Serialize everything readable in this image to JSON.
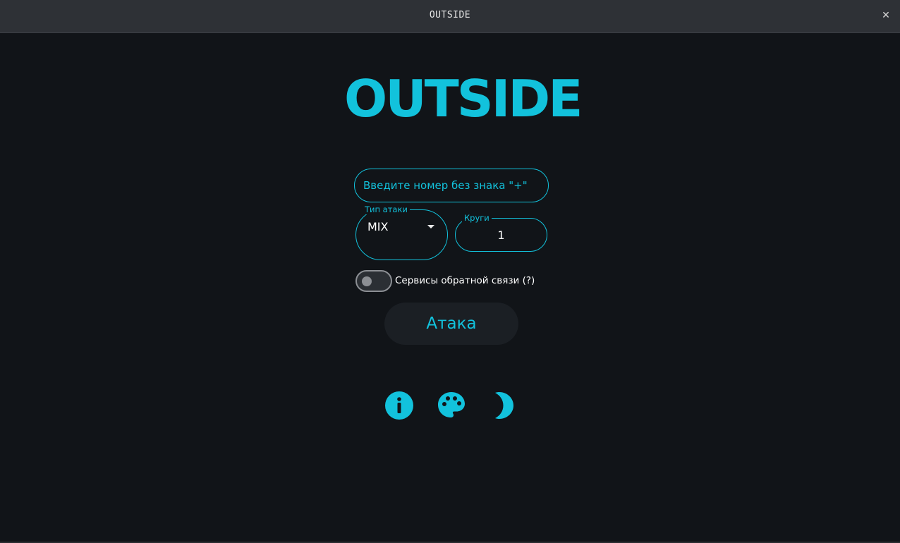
{
  "window": {
    "title": "OUTSIDE",
    "close_glyph": "✕"
  },
  "logo": {
    "text": "OUTSIDE",
    "color": "#12c2dc"
  },
  "form": {
    "phone": {
      "placeholder": "Введите номер без знака \"+\"",
      "value": ""
    },
    "attack_type": {
      "label": "Тип атаки",
      "selected": "MIX"
    },
    "rounds": {
      "label": "Круги",
      "value": "1"
    },
    "feedback_services": {
      "label": "Сервисы обратной связи (?)",
      "enabled": false
    },
    "attack_button": {
      "label": "Атака"
    }
  },
  "bottom_icons": [
    {
      "name": "info-icon"
    },
    {
      "name": "palette-icon"
    },
    {
      "name": "moon-icon"
    }
  ],
  "colors": {
    "accent": "#12c2dc",
    "background": "#111418",
    "titlebar": "#2e3136"
  }
}
